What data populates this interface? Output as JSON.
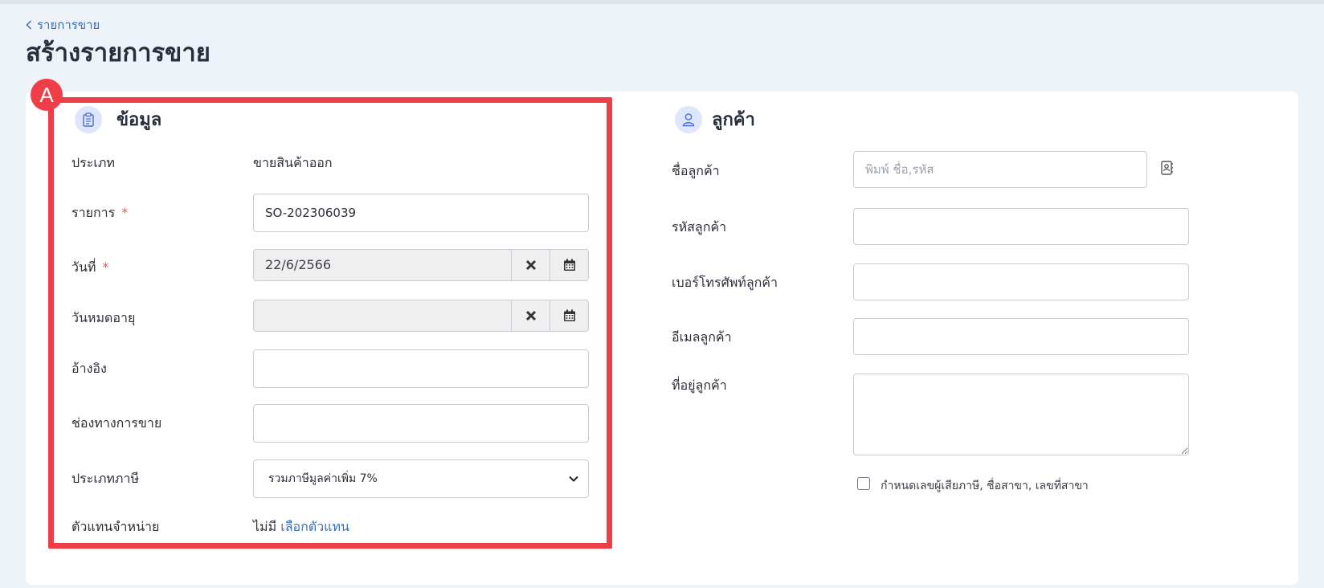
{
  "breadcrumb": {
    "label": "รายการขาย"
  },
  "page": {
    "title": "สร้างรายการขาย"
  },
  "info": {
    "title": "ข้อมูล",
    "icon": "clipboard-icon",
    "type_label": "ประเภท",
    "type_value": "ขายสินค้าออก",
    "doc_label": "รายการ",
    "doc_value": "SO-202306039",
    "date_label": "วันที่",
    "date_value": "22/6/2566",
    "expiry_label": "วันหมดอายุ",
    "expiry_value": "",
    "ref_label": "อ้างอิง",
    "ref_value": "",
    "channel_label": "ช่องทางการขาย",
    "channel_value": "",
    "tax_label": "ประเภทภาษี",
    "tax_value": "รวมภาษีมูลค่าเพิ่ม 7%",
    "agent_label": "ตัวแทนจำหน่าย",
    "agent_value": "ไม่มี",
    "agent_link": "เลือกตัวแทน",
    "required_mark": "*"
  },
  "customer": {
    "title": "ลูกค้า",
    "icon": "user-icon",
    "name_label": "ชื่อลูกค้า",
    "name_placeholder": "พิมพ์ ชื่อ,รหัส",
    "code_label": "รหัสลูกค้า",
    "phone_label": "เบอร์โทรศัพท์ลูกค้า",
    "email_label": "อีเมลลูกค้า",
    "address_label": "ที่อยู่ลูกค้า",
    "tax_checkbox_label": "กำหนดเลขผู้เสียภาษี, ชื่อสาขา, เลขที่สาขา"
  },
  "annotation": {
    "badge": "A",
    "color": "#ef3e47"
  },
  "colors": {
    "accent": "#3d6fb3",
    "required": "#e35a5a",
    "icon_bg": "#dde6fb"
  }
}
